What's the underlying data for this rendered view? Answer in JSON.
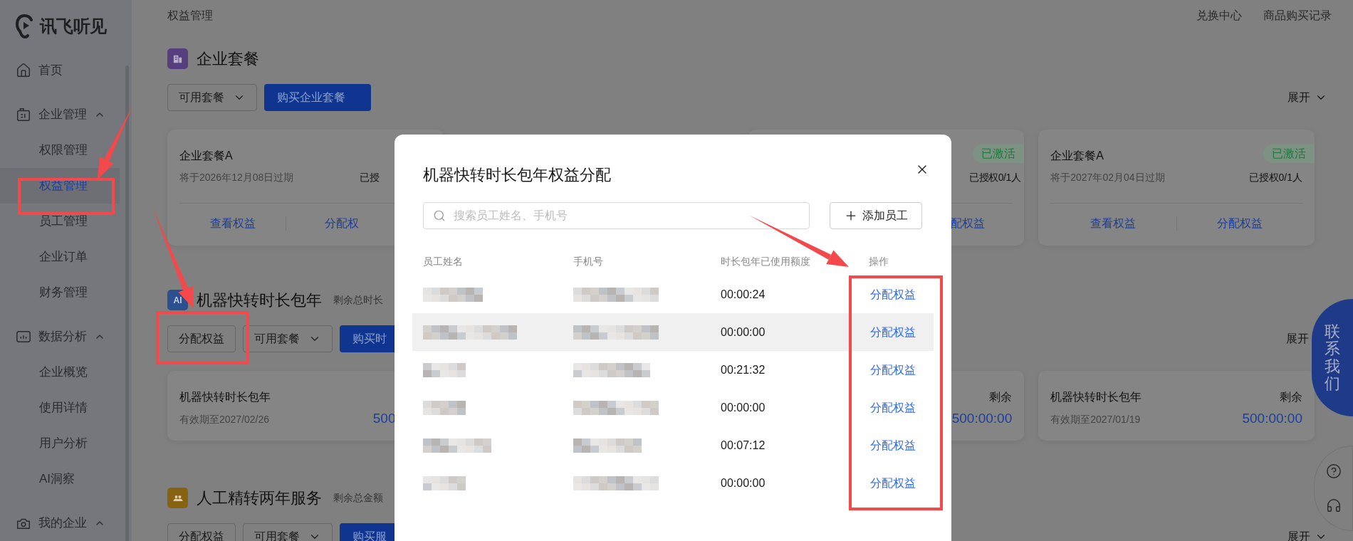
{
  "sidebar": {
    "logo": "讯飞听见",
    "items": [
      {
        "label": "首页",
        "kind": "link",
        "selected": false
      },
      {
        "label": "企业管理",
        "kind": "group",
        "expanded": true,
        "children": [
          {
            "label": "权限管理",
            "selected": false
          },
          {
            "label": "权益管理",
            "selected": true
          },
          {
            "label": "员工管理",
            "selected": false
          },
          {
            "label": "企业订单",
            "selected": false
          },
          {
            "label": "财务管理",
            "selected": false
          }
        ]
      },
      {
        "label": "数据分析",
        "kind": "group",
        "expanded": true,
        "children": [
          {
            "label": "企业概览",
            "selected": false
          },
          {
            "label": "使用详情",
            "selected": false
          },
          {
            "label": "用户分析",
            "selected": false
          },
          {
            "label": "AI洞察",
            "selected": false
          }
        ]
      },
      {
        "label": "我的企业",
        "kind": "group",
        "expanded": true
      }
    ]
  },
  "breadcrumb": "权益管理",
  "top_links": [
    "兑换中心",
    "商品购买记录"
  ],
  "sections": [
    {
      "kind": "package",
      "title": "企业套餐",
      "buttons": [
        {
          "label": "可用套餐",
          "kind": "dropdown"
        },
        {
          "label": "购买企业套餐",
          "kind": "primary"
        }
      ],
      "toggle": {
        "label": "展开",
        "caret": true
      },
      "cards": [
        {
          "title": "企业套餐A",
          "expiry": "将于2026年12月08日过期",
          "authorized": "已授",
          "view": "查看权益",
          "assign": "分配权"
        },
        {
          "badge": "已激活",
          "authorized": "已授权0/1人",
          "assign": "配权益"
        },
        {
          "title": "企业套餐A",
          "badge": "已激活",
          "expiry": "将于2027年02月04日过期",
          "authorized": "已授权0/1人",
          "view": "查看权益",
          "assign": "分配权益"
        }
      ]
    },
    {
      "kind": "duration",
      "icon_text": "AI",
      "title": "机器快转时长包年",
      "subtitle": "剩余总时长",
      "buttons": [
        {
          "label": "分配权益",
          "kind": "outline"
        },
        {
          "label": "可用套餐",
          "kind": "dropdown"
        },
        {
          "label": "购买时",
          "kind": "primary"
        }
      ],
      "toggle": {
        "label": "展开",
        "caret": false
      },
      "cards": [
        {
          "title": "机器快转时长包年",
          "validity": "有效期至2027/02/26",
          "remaining": "500"
        },
        {
          "remaining_label": "剩余",
          "remaining": "500:00:00"
        },
        {
          "title": "机器快转时长包年",
          "validity": "有效期至2027/01/19",
          "remaining_label": "剩余",
          "remaining": "500:00:00"
        }
      ]
    },
    {
      "kind": "service",
      "title": "人工精转两年服务",
      "subtitle": "剩余总金额",
      "buttons": [
        {
          "label": "分配权益",
          "kind": "outline"
        },
        {
          "label": "可用套餐",
          "kind": "dropdown"
        },
        {
          "label": "购买服",
          "kind": "primary"
        }
      ],
      "toggle": {
        "label": "展开",
        "caret": true
      }
    }
  ],
  "modal": {
    "title": "机器快转时长包年权益分配",
    "search": {
      "placeholder": "搜索员工姓名、手机号"
    },
    "add_button": "添加员工",
    "columns": [
      "员工姓名",
      "手机号",
      "时长包年已使用额度",
      "操作"
    ],
    "rows": [
      {
        "usage": "00:00:24",
        "action": "分配权益",
        "highlighted": false
      },
      {
        "usage": "00:00:00",
        "action": "分配权益",
        "highlighted": true
      },
      {
        "usage": "00:21:32",
        "action": "分配权益",
        "highlighted": false
      },
      {
        "usage": "00:00:00",
        "action": "分配权益",
        "highlighted": false
      },
      {
        "usage": "00:07:12",
        "action": "分配权益",
        "highlighted": false
      },
      {
        "usage": "00:00:00",
        "action": "分配权益",
        "highlighted": false
      }
    ]
  },
  "contact": "联系我们"
}
